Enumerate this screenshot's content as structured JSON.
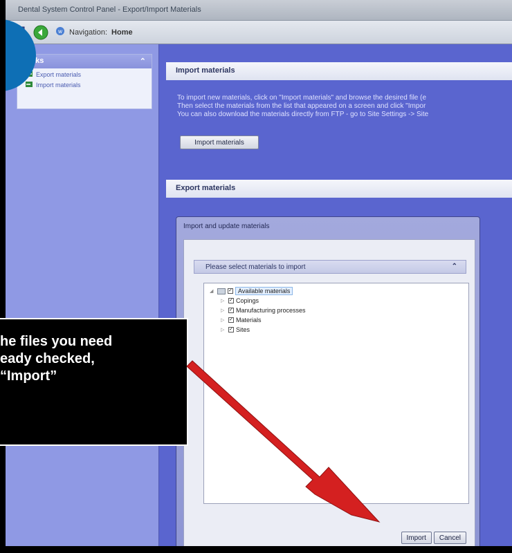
{
  "window": {
    "title": "Dental System Control Panel - Export/Import Materials"
  },
  "toolbar": {
    "navigation_label": "Navigation:",
    "navigation_value": "Home"
  },
  "sidebar": {
    "tasks_title": "Tasks",
    "items": [
      {
        "label": "Export materials",
        "icon": "export-icon"
      },
      {
        "label": "Import materials",
        "icon": "import-icon"
      }
    ]
  },
  "import_section": {
    "title": "Import materials",
    "lines": [
      "To import new materials, click on \"Import materials\" and browse the desired file (e",
      "Then select the materials from the list that appeared on a screen and click \"Impor",
      "You can also download the materials directly from FTP - go to Site Settings -> Site"
    ],
    "button_label": "Import materials"
  },
  "export_section": {
    "title": "Export materials"
  },
  "dialog": {
    "title": "Import and update materials",
    "subheader": "Please select materials to import",
    "tree": {
      "root": "Available materials",
      "children": [
        "Copings",
        "Manufacturing processes",
        "Materials",
        "Sites"
      ]
    },
    "import_button": "Import",
    "cancel_button": "Cancel"
  },
  "callout": {
    "lines": [
      "he files you need",
      "eady checked,",
      "“Import”"
    ]
  },
  "colors": {
    "background_blue": "#5a65cf",
    "arrow_red": "#d42020",
    "callout_bg": "#000000"
  }
}
